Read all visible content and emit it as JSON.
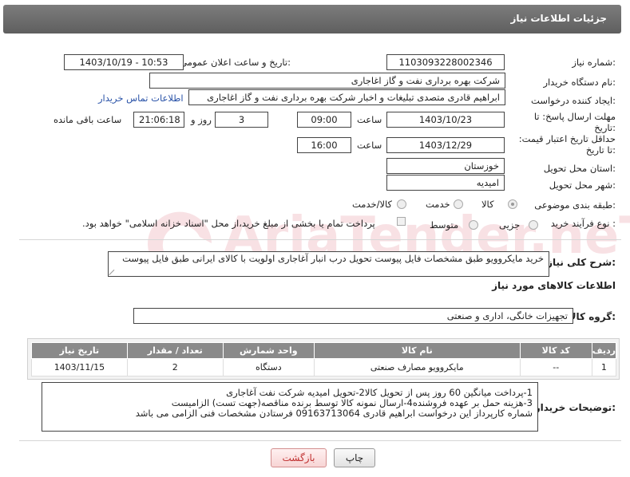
{
  "header": {
    "title": "جزئیات اطلاعات نیاز"
  },
  "labels": {
    "need_number": "شماره نیاز:",
    "announce_datetime": "تاریخ و ساعت اعلان عمومی:",
    "buyer_org": "نام دستگاه خریدار:",
    "requester": "ایجاد کننده درخواست:",
    "reply_deadline": "مهلت ارسال پاسخ: تا تاریخ:",
    "min_validity": "حداقل تاریخ اعتبار قیمت: تا تاریخ:",
    "delivery_province": "استان محل تحویل:",
    "delivery_city": "شهر محل تحویل:",
    "category": "طبقه بندی موضوعی:",
    "purchase_type": "نوع فرآیند خرید :",
    "summary": "شرح کلی نیاز:",
    "items_info": "اطلاعات کالاهای مورد نیاز",
    "goods_group": "گروه کالا:",
    "buyer_notes": "توضیحات خریدار:",
    "time": "ساعت",
    "time2": "ساعت",
    "day_and": "روز و",
    "remaining": "ساعت باقی مانده"
  },
  "values": {
    "need_number": "1103093228002346",
    "announce_datetime": "1403/10/19 - 10:53",
    "buyer_org": "شرکت بهره برداری نفت و گاز اغاجاری",
    "requester": "ابراهیم قادری متصدی تبلیغات و اخبار شرکت بهره برداری نفت و گاز اغاجاری",
    "contact_link": "اطلاعات تماس خریدار",
    "reply_date": "1403/10/23",
    "reply_time": "09:00",
    "days": "3",
    "remaining_time": "21:06:18",
    "validity_date": "1403/12/29",
    "validity_time": "16:00",
    "province": "خوزستان",
    "city": "امیدیه",
    "summary": "خرید مایکروویو طبق مشخصات فایل پیوست تحویل درب انبار آغاجاری اولویت با کالای ایرانی طبق فایل پیوست",
    "goods_group": "تجهیزات خانگی، اداری و صنعتی"
  },
  "category_options": [
    {
      "label": "کالا",
      "checked": true
    },
    {
      "label": "خدمت",
      "checked": false
    },
    {
      "label": "کالا/خدمت",
      "checked": false
    }
  ],
  "purchase_options": [
    {
      "label": "جزیی",
      "checked": false
    },
    {
      "label": "متوسط",
      "checked": false
    }
  ],
  "payment_note": "پرداخت تمام یا بخشی از مبلغ خرید،از محل \"اسناد خزانه اسلامی\" خواهد بود.",
  "table": {
    "headers": [
      "ردیف",
      "کد کالا",
      "نام کالا",
      "واحد شمارش",
      "تعداد / مقدار",
      "تاریخ نیاز"
    ],
    "rows": [
      [
        "1",
        "--",
        "مایکروویو مصارف صنعتی",
        "دستگاه",
        "2",
        "1403/11/15"
      ]
    ]
  },
  "notes_lines": [
    "1-پرداخت میانگین 60 روز پس از تحویل کالا2-تحویل امیدیه شرکت نفت آغاجاری",
    "3-هزینه حمل بر عهده فروشنده4-ارسال نمونه کالا توسط برنده مناقصه(جهت تست) الزامیست",
    "شماره کارپرداز این درخواست  ابراهیم قادری 09163713064 فرستادن مشخصات فنی الزامی می باشد"
  ],
  "buttons": {
    "print": "چاپ",
    "back": "بازگشت"
  },
  "watermark": "AriaTender.neT"
}
